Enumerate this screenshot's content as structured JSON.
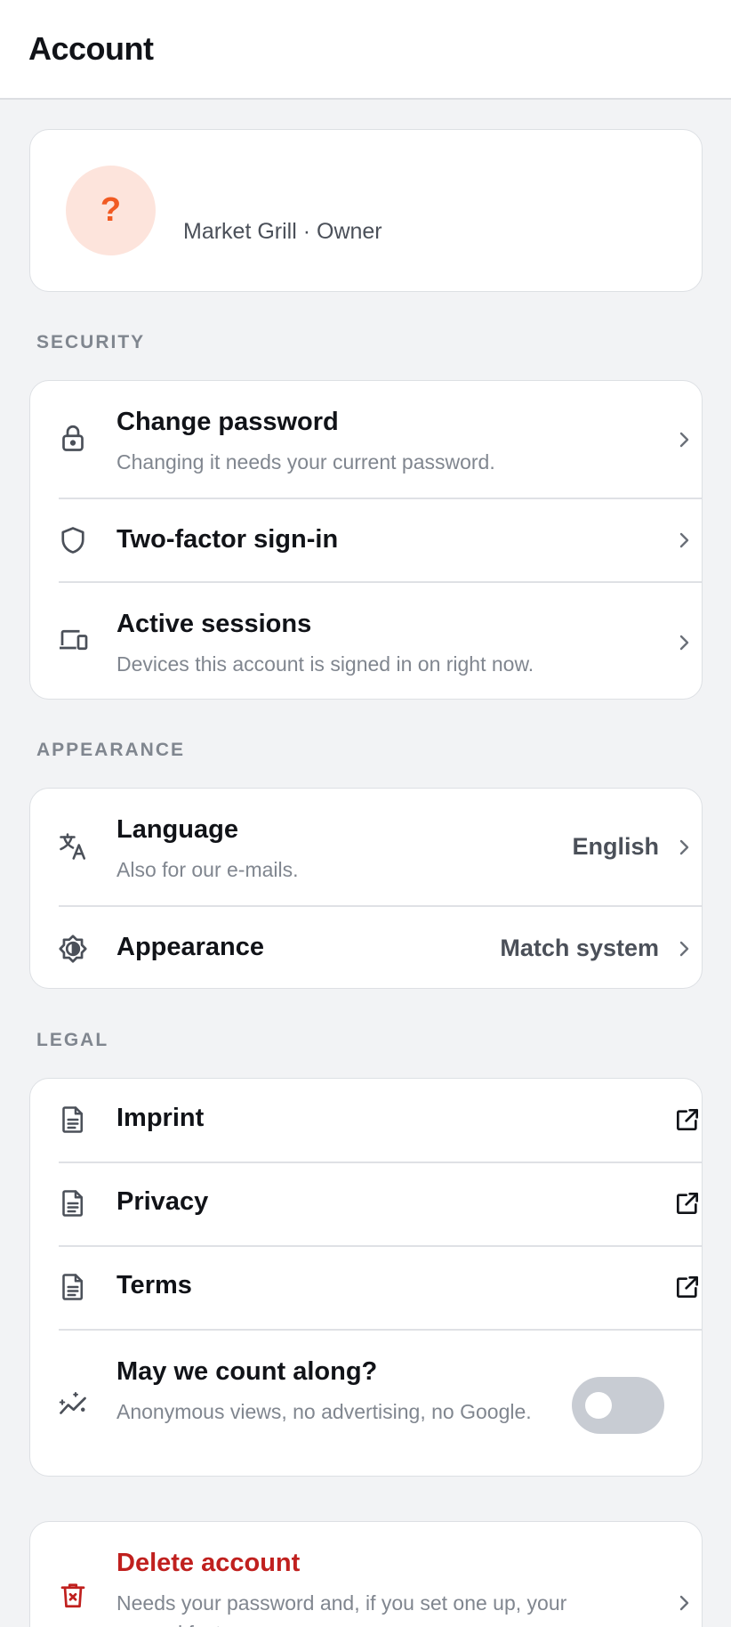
{
  "header": {
    "title": "Account"
  },
  "profile": {
    "avatar_glyph": "?",
    "subtitle": "Market Grill · Owner"
  },
  "security": {
    "title": "SECURITY",
    "items": [
      {
        "icon": "lock-icon",
        "label": "Change password",
        "sub": "Changing it needs your current password."
      },
      {
        "icon": "shield-icon",
        "label": "Two-factor sign-in"
      },
      {
        "icon": "devices-icon",
        "label": "Active sessions",
        "sub": "Devices this account is signed in on right now."
      }
    ]
  },
  "appearance": {
    "title": "APPEARANCE",
    "items": [
      {
        "icon": "translate-icon",
        "label": "Language",
        "sub": "Also for our e-mails.",
        "value": "English"
      },
      {
        "icon": "brightness-icon",
        "label": "Appearance",
        "value": "Match system"
      }
    ]
  },
  "legal": {
    "title": "LEGAL",
    "items": [
      {
        "icon": "document-icon",
        "label": "Imprint"
      },
      {
        "icon": "document-icon",
        "label": "Privacy"
      },
      {
        "icon": "document-icon",
        "label": "Terms"
      }
    ],
    "analytics": {
      "icon": "analytics-icon",
      "label": "May we count along?",
      "sub": "Anonymous views, no advertising, no Google.",
      "enabled": false
    }
  },
  "danger": {
    "icon": "trash-icon",
    "label": "Delete account",
    "sub": "Needs your password and, if you set one up, your second factor."
  },
  "colors": {
    "accent": "#f15a22",
    "danger": "#c0201e",
    "muted": "#80868f",
    "background": "#f2f3f5"
  }
}
